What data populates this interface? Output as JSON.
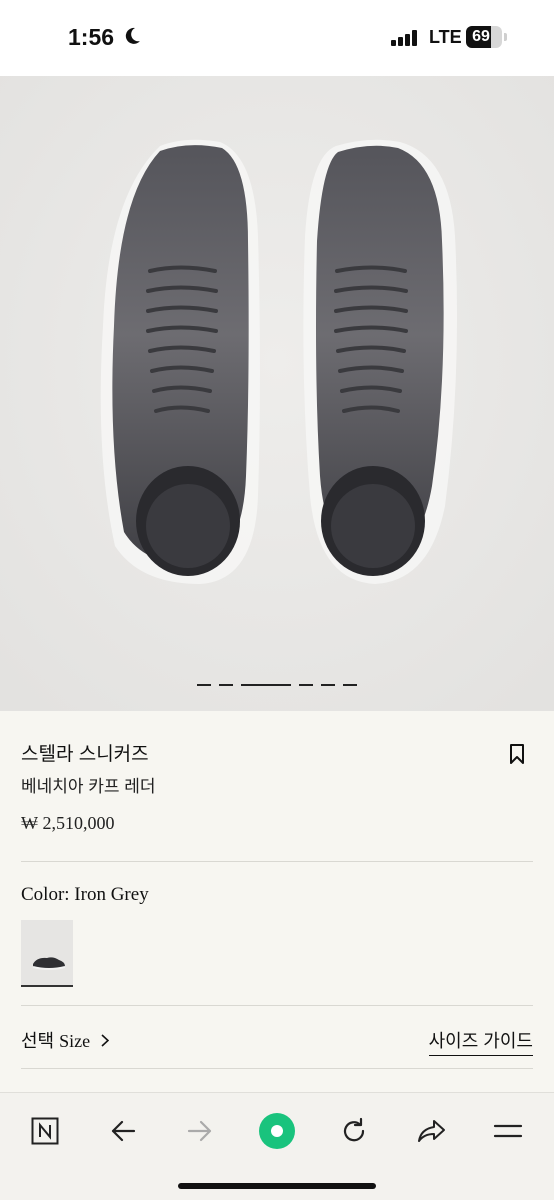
{
  "status_bar": {
    "time": "1:56",
    "network": "LTE",
    "battery_level": "69",
    "battery_fraction": 0.69,
    "icons": [
      "moon-icon",
      "signal-icon",
      "battery-icon"
    ]
  },
  "gallery": {
    "image": "shoe-pair-top-view",
    "slide_count": 6,
    "active_slide": 3
  },
  "product": {
    "title": "스텔라 스니커즈",
    "subtitle": "베네치아 카프 레더",
    "price": "₩ 2,510,000"
  },
  "color": {
    "label": "Color: Iron Grey",
    "swatch_name": "iron-grey-sneaker-thumbnail"
  },
  "size": {
    "label_korean": "선택",
    "label_english": "Size",
    "guide_link": "사이즈 가이드"
  },
  "browser_toolbar": {
    "buttons": [
      "naver-home-icon",
      "back-arrow-icon",
      "forward-arrow-icon",
      "green-dot-icon",
      "reload-icon",
      "share-icon",
      "menu-icon"
    ],
    "accent_color": "#19c37d"
  }
}
